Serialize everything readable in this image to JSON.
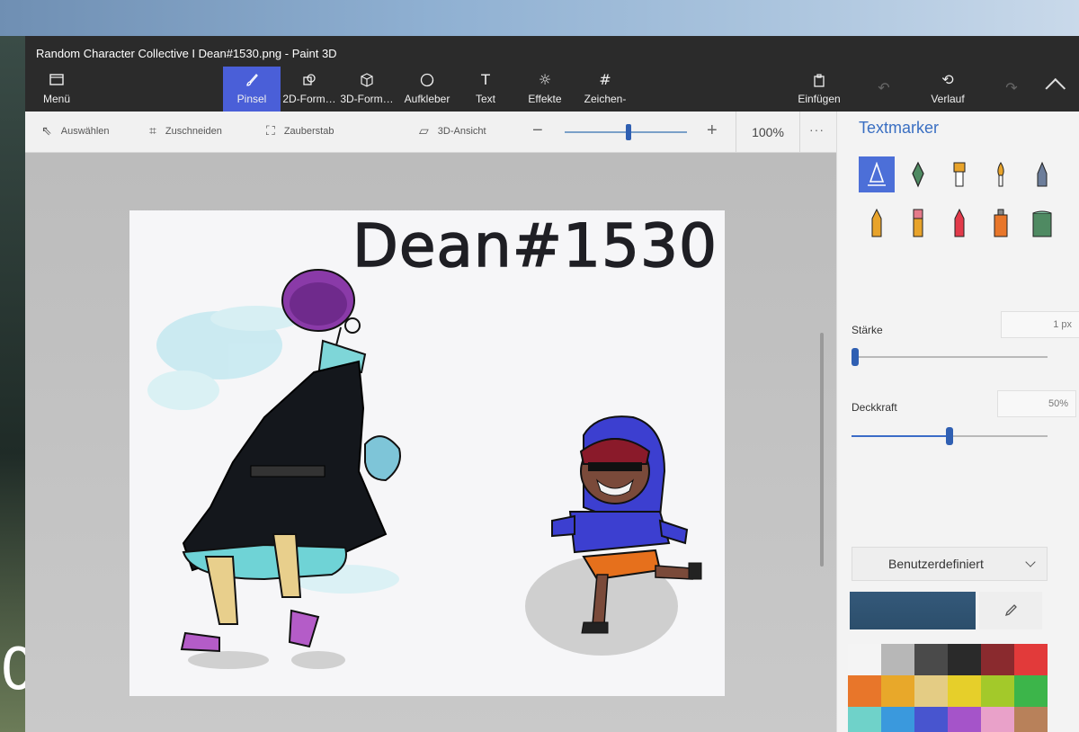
{
  "window": {
    "title": "Random Character Collective I Dean#1530.png - Paint 3D"
  },
  "ribbon": {
    "menu": {
      "label": "Menü",
      "icon": "folder-icon"
    },
    "tabs": [
      {
        "label": "Pinsel",
        "icon": "brush-icon",
        "active": true
      },
      {
        "label": "2D-Form…",
        "icon": "shapes-icon"
      },
      {
        "label": "3D-Form…",
        "icon": "cube-icon"
      },
      {
        "label": "Aufkleber",
        "icon": "sticker-icon"
      },
      {
        "label": "Text",
        "icon": "text-icon"
      },
      {
        "label": "Effekte",
        "icon": "effects-icon"
      },
      {
        "label": "Zeichen-",
        "icon": "canvas-icon"
      }
    ],
    "insert": {
      "label": "Einfügen",
      "icon": "insert-icon"
    },
    "history": {
      "label": "Verlauf",
      "icon": "history-icon"
    }
  },
  "toolbar": {
    "select_label": "Auswählen",
    "crop_label": "Zuschneiden",
    "magic_label": "Zauberstab",
    "view3d_label": "3D-Ansicht",
    "zoom_value": "100%",
    "zoom_level_fraction": 0.52,
    "more_label": "···"
  },
  "canvas": {
    "signature": "Dean#1530"
  },
  "panel": {
    "title": "Textmarker",
    "brushes": [
      {
        "name": "marker",
        "selected": true
      },
      {
        "name": "calligraphy-pen"
      },
      {
        "name": "oil-brush"
      },
      {
        "name": "watercolor"
      },
      {
        "name": "pixel-pen"
      },
      {
        "name": "pencil"
      },
      {
        "name": "eraser"
      },
      {
        "name": "crayon"
      },
      {
        "name": "spray-can"
      },
      {
        "name": "fill"
      }
    ],
    "size": {
      "label": "Stärke",
      "value": "1 px",
      "fraction": 0.02
    },
    "opacity": {
      "label": "Deckkraft",
      "value": "50%",
      "fraction": 0.5
    },
    "color_mode": "Benutzerdefiniert",
    "current_color": "#34597a",
    "swatches": [
      "#f4f4f4",
      "#b7b7b7",
      "#4a4a4a",
      "#2a2a2a",
      "#8a2a2e",
      "#e23a3a",
      "#e8762a",
      "#e8a82a",
      "#e4cc84",
      "#e6cf2a",
      "#a3c92a",
      "#3cb54a",
      "#6fd2c9",
      "#3a99dd",
      "#4855cf",
      "#a554c9",
      "#e9a1c9",
      "#b8815a"
    ],
    "custom_swatch": "#f2a7c0",
    "add_label": "+"
  }
}
